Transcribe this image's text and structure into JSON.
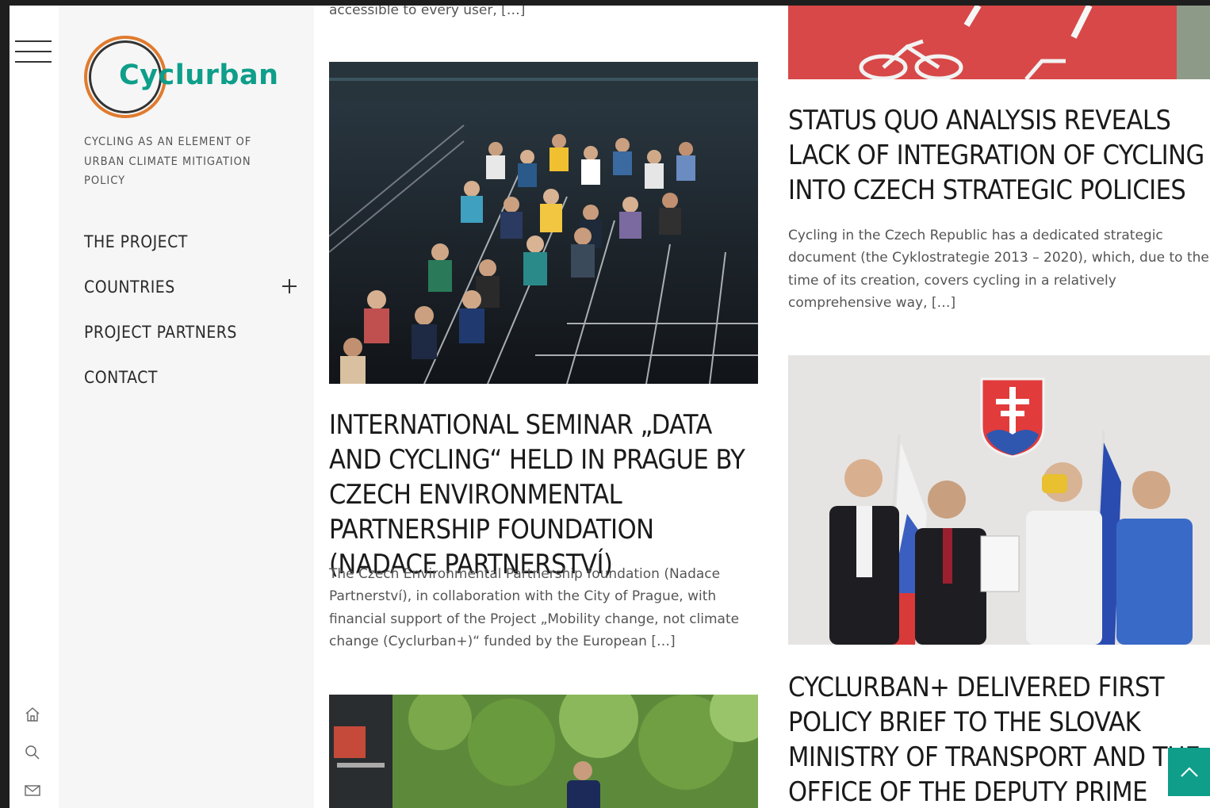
{
  "brand": {
    "logo_text": "Cyclurban",
    "tagline": "CYCLING AS AN ELEMENT OF URBAN CLIMATE MITIGATION POLICY",
    "accent_color": "#0e9e8a",
    "ring_color": "#e07b2e"
  },
  "nav": {
    "items": [
      {
        "label": "THE PROJECT"
      },
      {
        "label": "COUNTRIES",
        "expandable": true
      },
      {
        "label": "PROJECT PARTNERS"
      },
      {
        "label": "CONTACT"
      }
    ]
  },
  "side_icons": [
    "home-icon",
    "search-icon",
    "mail-icon"
  ],
  "posts": {
    "col1_top_excerpt": "accessible to every user, […]",
    "seminar": {
      "title": "INTERNATIONAL SEMINAR „DATA AND CYCLING“ HELD IN PRAGUE BY CZECH ENVIRONMENTAL PARTNERSHIP FOUNDATION (NADACE PARTNERSTVÍ)",
      "excerpt": "The Czech Environmental Partnership foundation (Nadace Partnerství), in collaboration with the City of Prague, with financial support of the Project „Mobility change, not climate change (Cyclurban+)“ funded by the European […]"
    },
    "status_quo": {
      "title": "STATUS QUO ANALYSIS REVEALS LACK OF INTEGRATION OF CYCLING INTO CZECH STRATEGIC POLICIES",
      "excerpt": "Cycling in the Czech Republic has a dedicated strategic document (the Cyklostrategie 2013 – 2020), which, due to the time of its creation, covers cycling in a relatively comprehensive way, […]"
    },
    "policy_brief": {
      "title": "CYCLURBAN+ DELIVERED FIRST POLICY BRIEF TO THE SLOVAK MINISTRY OF TRANSPORT AND THE OFFICE OF THE DEPUTY PRIME MINISTER"
    }
  }
}
